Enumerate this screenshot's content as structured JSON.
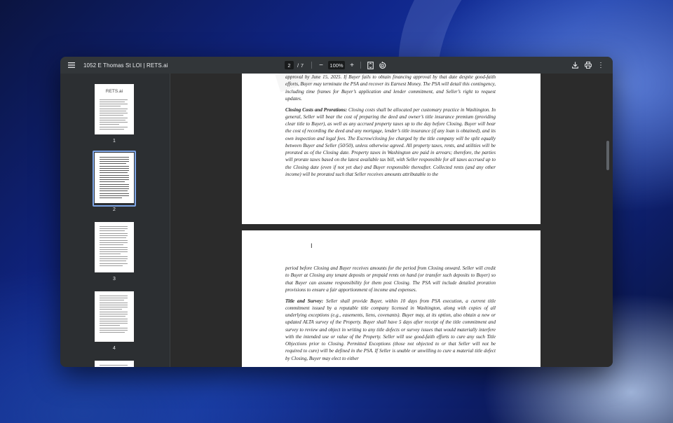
{
  "window": {
    "title": "1052 E Thomas St LOI | RETS.ai"
  },
  "toolbar": {
    "current_page": "2",
    "page_separator": "/",
    "total_pages": "7",
    "zoom_level": "100%",
    "zoom_out_label": "−",
    "zoom_in_label": "+",
    "more_label": "⋮",
    "icons": {
      "menu": "menu-icon",
      "fit": "fit-to-page-icon",
      "rotate": "rotate-icon",
      "download": "download-icon",
      "print": "print-icon",
      "more": "more-vertical-icon"
    }
  },
  "sidebar": {
    "thumbnails": [
      {
        "number": "1",
        "logo": "RETS.ai",
        "selected": false
      },
      {
        "number": "2",
        "selected": true
      },
      {
        "number": "3",
        "selected": false
      },
      {
        "number": "4",
        "selected": false
      }
    ]
  },
  "document": {
    "page1_bottom": {
      "intro_lines": "approval by June 15, 2025. If Buyer fails to obtain financing approval by that date despite good-faith efforts, Buyer may terminate the PSA and recover its Earnest Money. The PSA will detail this contingency, including time frames for Buyer’s application and lender commitment, and Seller’s right to request updates.",
      "closing_heading": "Closing Costs and Prorations:",
      "closing_body": "Closing costs shall be allocated per customary practice in Washington. In general, Seller will bear the cost of preparing the deed and owner’s title insurance premium (providing clear title to Buyer), as well as any accrued property taxes up to the day before Closing. Buyer will bear the cost of recording the deed and any mortgage, lender’s title insurance (if any loan is obtained), and its own inspection and legal fees. The Escrow/closing fee charged by the title company will be split equally between Buyer and Seller (50/50), unless otherwise agreed. All property taxes, rents, and utilities will be prorated as of the Closing date. Property taxes in Washington are paid in arrears; therefore, the parties will prorate taxes based on the latest available tax bill, with Seller responsible for all taxes accrued up to the Closing date (even if not yet due) and Buyer responsible thereafter. Collected rents (and any other income) will be prorated such that Seller receives amounts attributable to the"
    },
    "page2_top": {
      "continuation": "period before Closing and Buyer receives amounts for the period from Closing onward. Seller will credit to Buyer at Closing any tenant deposits or prepaid rents on hand (or transfer such deposits to Buyer) so that Buyer can assume responsibility for them post Closing. The PSA will include detailed proration provisions to ensure a fair apportionment of income and expenses.",
      "title_heading": "Title and Survey:",
      "title_body": "Seller shall provide Buyer, within 10 days from PSA execution, a current title commitment issued by a reputable title company licensed in Washington, along with copies of all underlying exceptions (e.g., easements, liens, covenants). Buyer may, at its option, also obtain a new or updated ALTA survey of the Property. Buyer shall have 5 days after receipt of the title commitment and survey to review and object in writing to any title defects or survey issues that would materially interfere with the intended use or value of the Property. Seller will use good-faith efforts to cure any such Title Objections prior to Closing. Permitted Exceptions (those not objected to or that Seller will not be required to cure) will be defined in the PSA. If Seller is unable or unwilling to cure a material title defect by Closing, Buyer may elect to either"
    },
    "cursor_glyph": "I"
  }
}
